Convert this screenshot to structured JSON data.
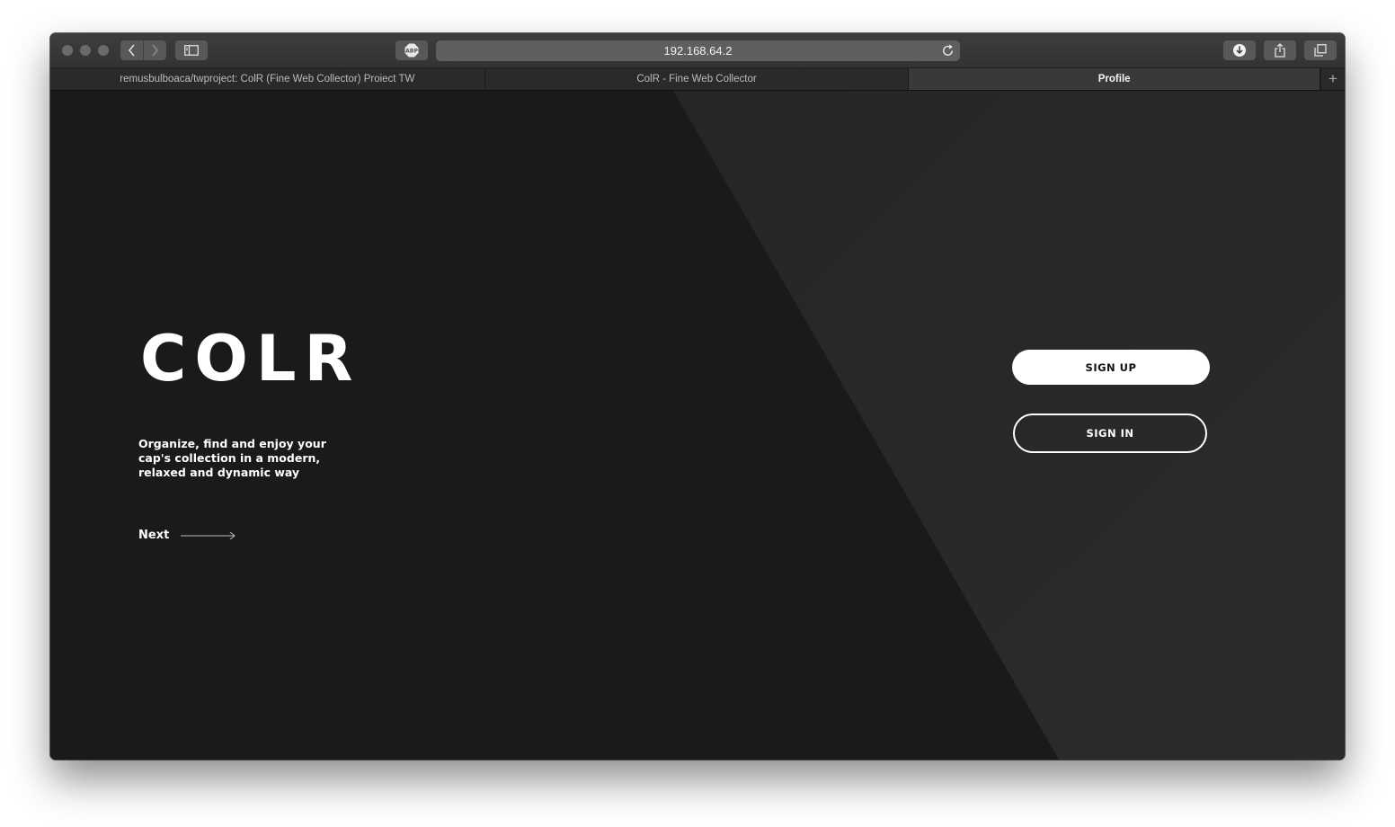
{
  "browser": {
    "address": "192.168.64.2",
    "adblock_label": "ABP",
    "new_tab_symbol": "+",
    "tabs": [
      {
        "label": "remusbulboaca/twproject: ColR (Fine Web Collector) Proiect TW",
        "active": false
      },
      {
        "label": "ColR - Fine Web Collector",
        "active": false
      },
      {
        "label": "Profile",
        "active": true
      }
    ]
  },
  "page": {
    "logo": "COLR",
    "tagline": "Organize, find and enjoy your cap's collection in a modern, relaxed and dynamic way",
    "next_label": "Next",
    "signup_label": "SIGN UP",
    "signin_label": "SIGN IN"
  },
  "colors": {
    "background": "#1a1a1a",
    "diagonal_panel": "#262626",
    "foreground": "#ffffff"
  }
}
